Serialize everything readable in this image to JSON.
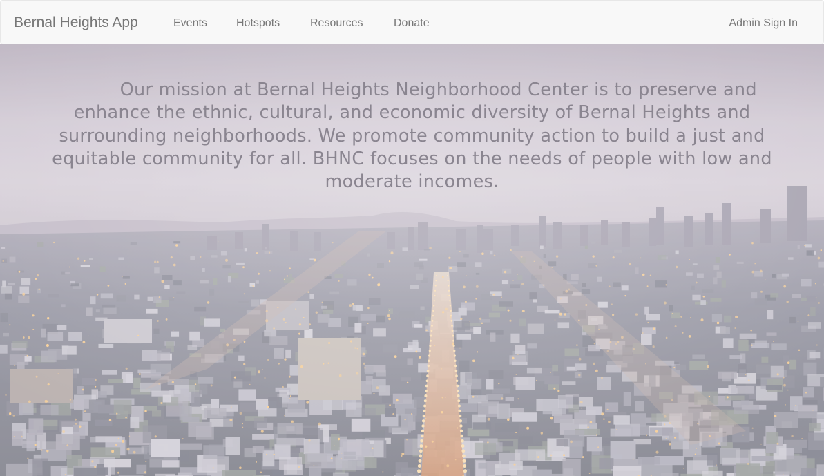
{
  "nav": {
    "brand": "Bernal Heights App",
    "links": [
      {
        "label": "Events"
      },
      {
        "label": "Hotspots"
      },
      {
        "label": "Resources"
      },
      {
        "label": "Donate"
      }
    ],
    "admin_label": "Admin Sign In"
  },
  "hero": {
    "mission": "Our mission at Bernal Heights Neighborhood Center is to preserve and enhance the ethnic, cultural, and economic diversity of Bernal Heights and surrounding neighborhoods. We promote community action to build a just and equitable community for all. BHNC focuses on the needs of people with low and moderate incomes."
  },
  "colors": {
    "navbar_bg": "#f8f8f8",
    "nav_text": "#777777",
    "mission_text": "#8a8590",
    "sky": "#c9c0cc",
    "city_lights": "#ffd08a"
  }
}
